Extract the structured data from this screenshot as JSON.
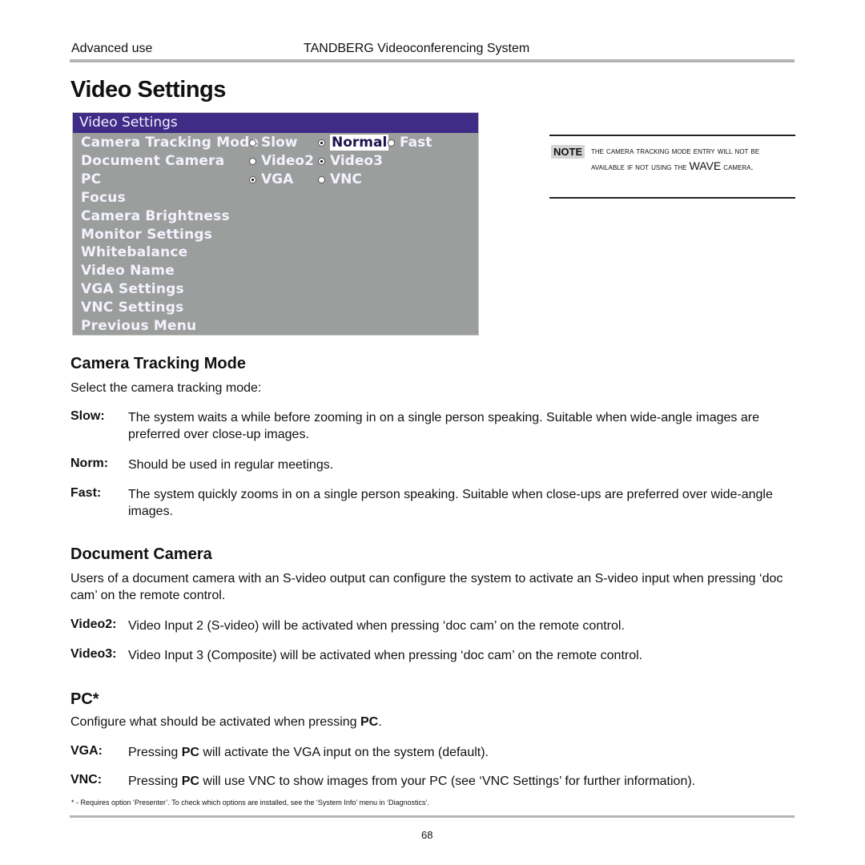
{
  "header": {
    "section": "Advanced use",
    "product": "TANDBERG Videoconferencing System"
  },
  "page_title": "Video Settings",
  "osd_menu": {
    "title": "Video Settings",
    "colors": {
      "title_bar": "#3f2c87",
      "background": "#9b9e9c",
      "text": "#f4f2ff"
    },
    "items": [
      {
        "label": "Camera Tracking Mode",
        "options": [
          {
            "label": "Slow",
            "selected": false
          },
          {
            "label": "Normal",
            "selected": true,
            "highlighted": true
          },
          {
            "label": "Fast",
            "selected": false
          }
        ]
      },
      {
        "label": "Document Camera",
        "options": [
          {
            "label": "Video2",
            "selected": false
          },
          {
            "label": "Video3",
            "selected": true
          }
        ]
      },
      {
        "label": "PC",
        "options": [
          {
            "label": "VGA",
            "selected": true
          },
          {
            "label": "VNC",
            "selected": false
          }
        ]
      },
      {
        "label": "Focus"
      },
      {
        "label": "Camera Brightness"
      },
      {
        "label": "Monitor Settings"
      },
      {
        "label": "Whitebalance"
      },
      {
        "label": "Video Name"
      },
      {
        "label": "VGA Settings"
      },
      {
        "label": "VNC Settings"
      },
      {
        "label": "Previous Menu"
      }
    ]
  },
  "note": {
    "tag": "NOTE",
    "text_a": "The Camera Tracking Mode entry will not be available if not using the ",
    "text_b": "WAVE",
    "text_c": " Camera."
  },
  "sections": {
    "camera_tracking": {
      "heading": "Camera Tracking Mode",
      "intro": "Select the camera tracking mode:",
      "terms": [
        {
          "term": "Slow:",
          "def": "The system waits a while before zooming in on a single person speaking. Suitable when wide-angle images are preferred over close-up images."
        },
        {
          "term": "Norm:",
          "def": "Should be used in regular meetings."
        },
        {
          "term": "Fast:",
          "def": "The system quickly zooms in on a single person speaking. Suitable when close-ups are preferred over wide-angle images."
        }
      ]
    },
    "document_camera": {
      "heading": "Document Camera",
      "intro": "Users of a document camera with an S-video output can configure the system to activate an S-video input when pressing ‘doc cam’ on the remote control.",
      "terms": [
        {
          "term": "Video2:",
          "def": "Video Input 2 (S-video) will be activated when pressing ‘doc cam’ on the remote control."
        },
        {
          "term": "Video3:",
          "def": "Video Input 3 (Composite) will be activated when pressing ‘doc cam’ on the remote control."
        }
      ]
    },
    "pc": {
      "heading": "PC*",
      "intro_a": "Configure what should be activated when pressing ",
      "intro_b": "PC",
      "intro_c": ".",
      "terms": [
        {
          "term": "VGA:",
          "def_a": "Pressing ",
          "def_b": "PC",
          "def_c": " will activate the VGA input on the system (default)."
        },
        {
          "term": "VNC:",
          "def_a": "Pressing ",
          "def_b": "PC",
          "def_c": " will use VNC to show images from your PC (see ‘VNC Settings’ for further information)."
        }
      ],
      "footnote": "* - Requires option ‘Presenter’. To check which options are installed, see the ‘System Info’ menu in ‘Diagnostics’."
    }
  },
  "page_number": "68"
}
